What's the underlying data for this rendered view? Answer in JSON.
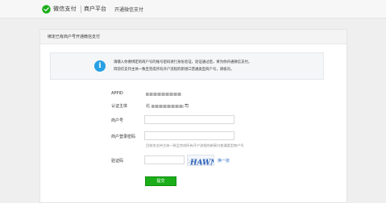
{
  "header": {
    "brand": "微信支付",
    "platform": "商户平台",
    "subtitle": "开通微信支付"
  },
  "panel": {
    "title": "绑定已有商户号开通微信支付"
  },
  "notice": {
    "line1": "请输入你要绑定的商户号的账号密码进行身份验证，验证通过后，将为你开通微信支付。",
    "line2": "目前仅支持主体一致且完成所有开户流程的新接口普通类型商户号，请核对。"
  },
  "form": {
    "appid_label": "APPID",
    "auth_label": "认证主体",
    "auth_value_prefix": "北",
    "auth_value_suffix": "司",
    "merchant_label": "商户号",
    "merchant_value": "",
    "login_pwd_label": "商户登录密码",
    "login_pwd_value": "",
    "hint": "目前仅支持主体一致且完成所有开户流程的新接口普通类型商户号",
    "captcha_label": "验证码",
    "captcha_value": "",
    "captcha_text": "HAWN",
    "refresh_label": "换一张",
    "submit_label": "提交"
  },
  "colors": {
    "brand_green": "#1aad19",
    "info_blue": "#27a0e3",
    "link_blue": "#2a6cc0"
  }
}
